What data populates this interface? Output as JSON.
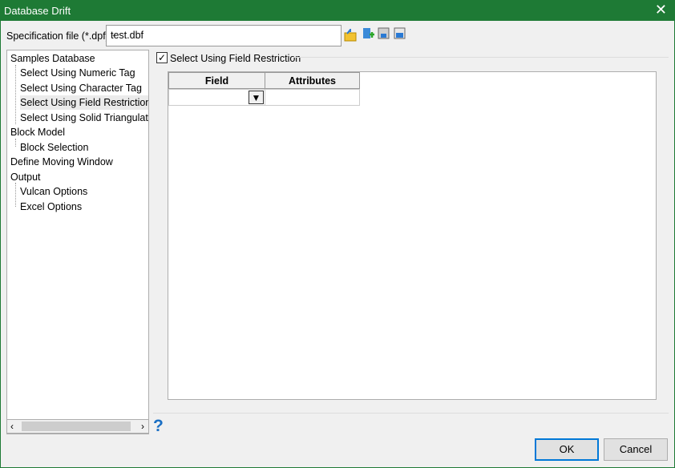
{
  "window": {
    "title": "Database Drift",
    "close": "✕"
  },
  "spec": {
    "label": "Specification file (*.dpf)",
    "value": "test.dbf"
  },
  "tree": [
    {
      "label": "Samples Database",
      "level": 0
    },
    {
      "label": "Select Using Numeric Tag",
      "level": 1
    },
    {
      "label": "Select Using Character Tag",
      "level": 1
    },
    {
      "label": "Select Using Field Restriction",
      "level": 1,
      "selected": true
    },
    {
      "label": "Select Using Solid Triangulation",
      "level": 1
    },
    {
      "label": "Block Model",
      "level": 0
    },
    {
      "label": "Block Selection",
      "level": 1
    },
    {
      "label": "Define Moving Window",
      "level": 0
    },
    {
      "label": "Output",
      "level": 0
    },
    {
      "label": "Vulcan Options",
      "level": 1
    },
    {
      "label": "Excel Options",
      "level": 1
    }
  ],
  "restriction": {
    "label": "Select Using Field Restriction",
    "checked": true
  },
  "grid": {
    "headers": [
      "Field",
      "Attributes"
    ],
    "rows": [
      [
        "",
        ""
      ]
    ]
  },
  "buttons": {
    "ok": "OK",
    "cancel": "Cancel",
    "help": "?"
  }
}
